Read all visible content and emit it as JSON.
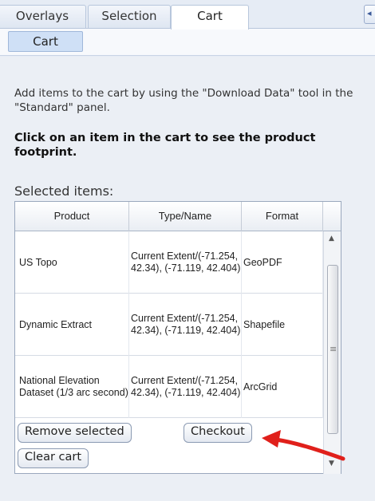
{
  "tabs": [
    {
      "label": "Overlays"
    },
    {
      "label": "Selection"
    },
    {
      "label": "Cart"
    }
  ],
  "subtab": {
    "label": "Cart"
  },
  "info_text": "Add items to the cart by using the \"Download Data\" tool in the \"Standard\" panel.",
  "bold_note": "Click on an item in the cart to see the product footprint.",
  "selected_label": "Selected items:",
  "table": {
    "headers": [
      "Product",
      "Type/Name",
      "Format"
    ],
    "rows": [
      {
        "product": "US Topo",
        "type_name": "Current Extent/(-71.254, 42.34), (-71.119, 42.404)",
        "format": "GeoPDF"
      },
      {
        "product": "Dynamic Extract",
        "type_name": "Current Extent/(-71.254, 42.34), (-71.119, 42.404)",
        "format": "Shapefile"
      },
      {
        "product": "National Elevation Dataset (1/3 arc second)",
        "type_name": "Current Extent/(-71.254, 42.34), (-71.119, 42.404)",
        "format": "ArcGrid"
      }
    ]
  },
  "buttons": {
    "remove_selected": "Remove selected",
    "checkout": "Checkout",
    "clear_cart": "Clear cart"
  },
  "colors": {
    "annotation_arrow": "#e0201b",
    "tab_border": "#b7c6dc",
    "subtab_bg": "#cfe0f6"
  }
}
